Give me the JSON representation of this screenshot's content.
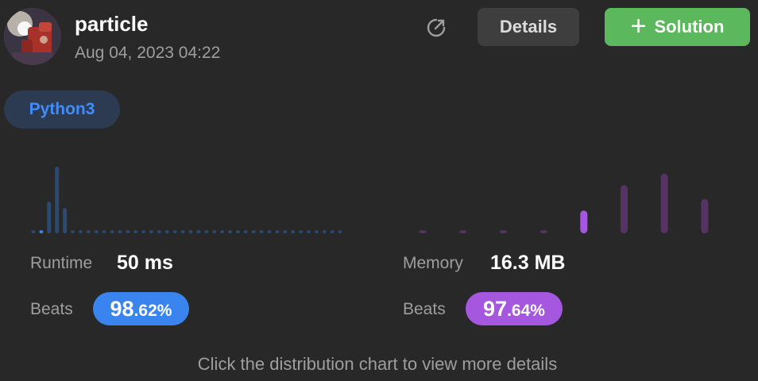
{
  "header": {
    "username": "particle",
    "timestamp": "Aug 04, 2023 04:22",
    "details_label": "Details",
    "solution_label": "Solution"
  },
  "language": "Python3",
  "runtime": {
    "label": "Runtime",
    "value": "50 ms",
    "beats_label": "Beats",
    "beats_int": "98",
    "beats_frac": ".62%"
  },
  "memory": {
    "label": "Memory",
    "value": "16.3 MB",
    "beats_label": "Beats",
    "beats_int": "97",
    "beats_frac": ".64%"
  },
  "footer_text": "Click the distribution chart to view more details",
  "colors": {
    "runtime_bar": "#2b4a72",
    "runtime_highlight": "#3a84f0",
    "memory_bar": "#553463",
    "memory_highlight": "#a657e0"
  },
  "chart_data": [
    {
      "type": "bar",
      "name": "runtime-distribution",
      "values": [
        0.4,
        0.5,
        5,
        10.5,
        4,
        0.4,
        0.4,
        0.4,
        0.4,
        0.4,
        0.4,
        0.4,
        0.4,
        0.4,
        0.4,
        0.4,
        0.4,
        0.4,
        0.4,
        0.4,
        0.4,
        0.4,
        0.4,
        0.4,
        0.4,
        0.4,
        0.4,
        0.4,
        0.4,
        0.4,
        0.4,
        0.4,
        0.4,
        0.4,
        0.4,
        0.4,
        0.4,
        0.4,
        0.4,
        0.4
      ],
      "highlight_index": 1
    },
    {
      "type": "bar",
      "name": "memory-distribution",
      "values": [
        0.4,
        0.4,
        0.4,
        0.4,
        3.6,
        7.6,
        9.4,
        5.4
      ],
      "highlight_index": 4
    }
  ]
}
